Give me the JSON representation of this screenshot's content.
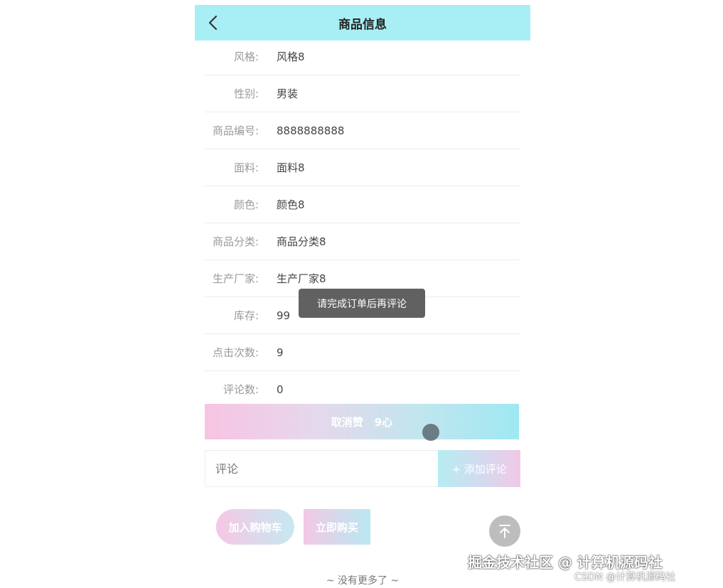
{
  "header": {
    "title": "商品信息"
  },
  "info_rows": [
    {
      "label": "风格:",
      "value": "风格8"
    },
    {
      "label": "性别:",
      "value": "男装"
    },
    {
      "label": "商品编号:",
      "value": "8888888888"
    },
    {
      "label": "面料:",
      "value": "面料8"
    },
    {
      "label": "颜色:",
      "value": "颜色8"
    },
    {
      "label": "商品分类:",
      "value": "商品分类8"
    },
    {
      "label": "生产厂家:",
      "value": "生产厂家8"
    },
    {
      "label": "库存:",
      "value": "99"
    },
    {
      "label": "点击次数:",
      "value": "9"
    },
    {
      "label": "评论数:",
      "value": "0"
    }
  ],
  "collect": {
    "label": "取消赞",
    "count": "9心"
  },
  "comment": {
    "placeholder": "评论",
    "add_label": "+ 添加评论"
  },
  "actions": {
    "cart_label": "加入购物车",
    "buy_label": "立即购买"
  },
  "footer": {
    "no_more": "~ 没有更多了 ~"
  },
  "toast": {
    "message": "请完成订单后再评论"
  },
  "watermark": {
    "line1": "掘金技术社区 @ 计算机源码社",
    "line2": "CSDN @计算机源码社"
  },
  "colors": {
    "header_bg": "#a8eef5",
    "gradient_pink": "#f7c4e2",
    "gradient_cyan": "#9fe8f3"
  }
}
